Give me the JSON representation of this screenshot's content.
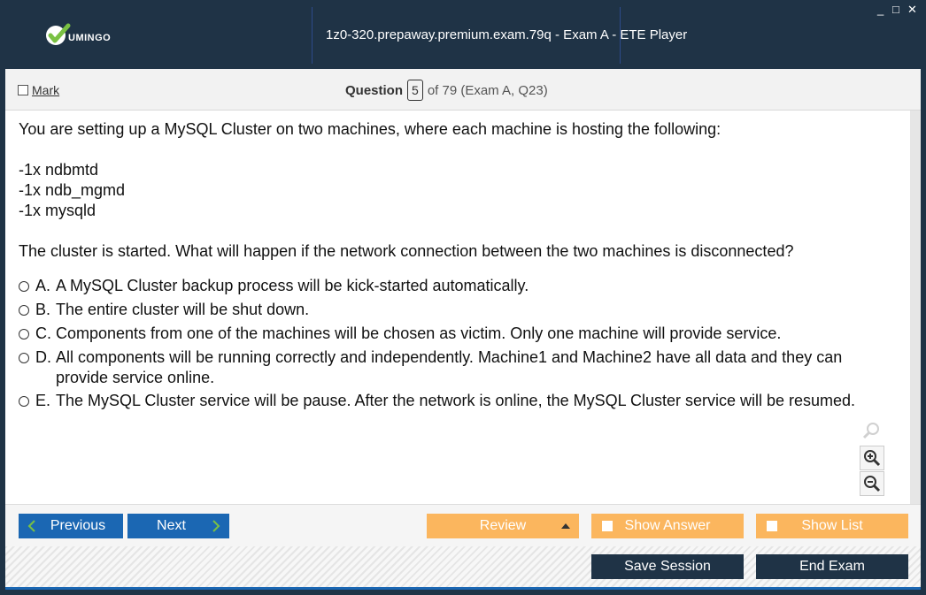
{
  "window": {
    "logo_text": "UMINGO",
    "title": "1z0-320.prepaway.premium.exam.79q - Exam A - ETE Player",
    "controls": [
      "_",
      "□",
      "✕"
    ]
  },
  "header": {
    "mark_label": "Mark",
    "question_label": "Question",
    "question_number": "5",
    "of_text": "of 79 (Exam A, Q23)"
  },
  "question": {
    "intro": "You are setting up a MySQL Cluster on two machines, where each machine is hosting the following:",
    "items": [
      "-1x ndbmtd",
      "-1x ndb_mgmd",
      "-1x mysqld"
    ],
    "prompt": "The cluster is started. What will happen if the network connection between the two machines is disconnected?",
    "options": [
      {
        "letter": "A.",
        "text": "A MySQL Cluster backup process will be kick-started automatically."
      },
      {
        "letter": "B.",
        "text": "The entire cluster will be shut down."
      },
      {
        "letter": "C.",
        "text": "Components from one of the machines will be chosen as victim. Only one machine will provide service."
      },
      {
        "letter": "D.",
        "text": "All components will be running correctly and independently. Machine1 and Machine2 have all data and they can provide service online."
      },
      {
        "letter": "E.",
        "text": "The MySQL Cluster service will be pause. After the network is online, the MySQL Cluster service will be resumed."
      }
    ]
  },
  "nav": {
    "previous": "Previous",
    "next": "Next",
    "review": "Review",
    "show_answer": "Show Answer",
    "show_list": "Show List"
  },
  "footer": {
    "save_session": "Save Session",
    "end_exam": "End Exam"
  },
  "colors": {
    "titlebar": "#1f3346",
    "primary_button": "#1b67b3",
    "accent_button": "#fbb65e",
    "dark_button": "#1f3346"
  }
}
